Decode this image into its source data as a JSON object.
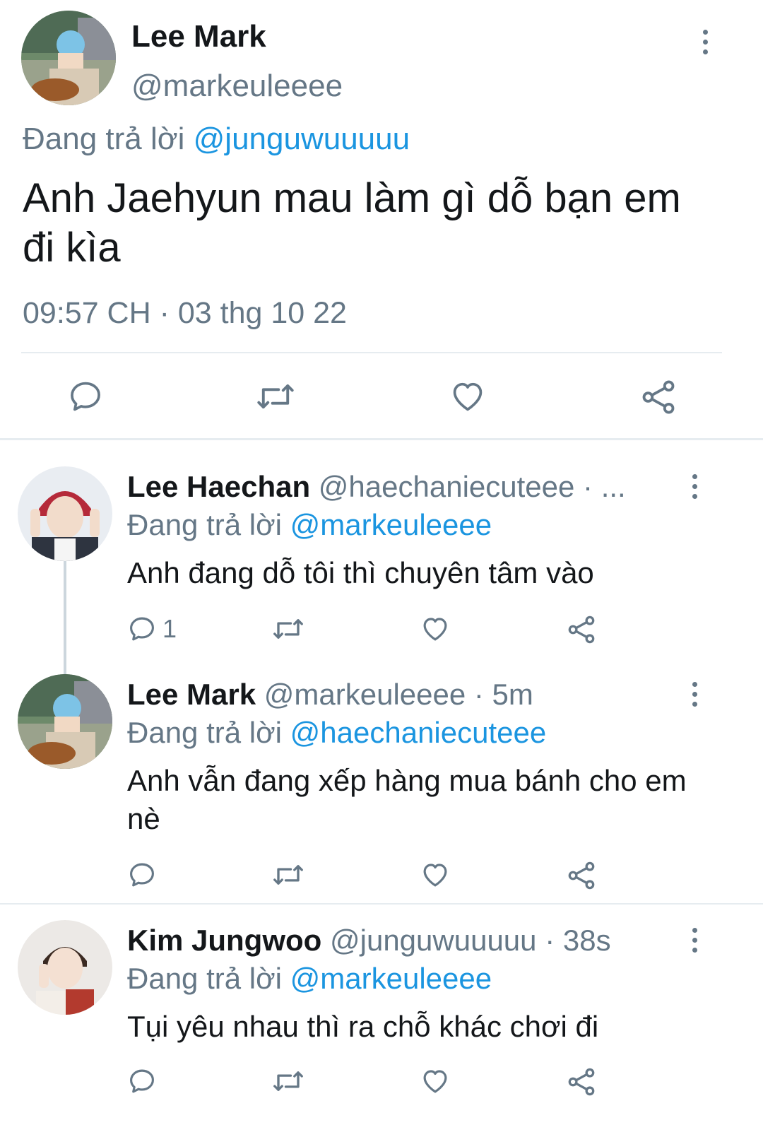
{
  "main_tweet": {
    "author_name": "Lee Mark",
    "author_handle": "@markeuleeee",
    "replying_prefix": "Đang trả lời",
    "replying_to": "@junguwuuuuu",
    "text": "Anh Jaehyun mau làm gì dỗ bạn em đi kìa",
    "timestamp": "09:57 CH · 03 thg 10 22"
  },
  "replies": [
    {
      "author_name": "Lee Haechan",
      "author_handle": "@haechaniecuteee · ...",
      "replying_prefix": "Đang trả lời",
      "replying_to": "@markeuleeee",
      "text": "Anh đang dỗ tôi thì chuyên tâm vào",
      "reply_count": "1"
    },
    {
      "author_name": "Lee Mark",
      "author_handle": "@markeuleeee · 5m",
      "replying_prefix": "Đang trả lời",
      "replying_to": "@haechaniecuteee",
      "text": "Anh vẫn đang xếp hàng mua bánh cho em nè",
      "reply_count": ""
    },
    {
      "author_name": "Kim Jungwoo",
      "author_handle": "@junguwuuuuu · 38s",
      "replying_prefix": "Đang trả lời",
      "replying_to": "@markeuleeee",
      "text": "Tụi yêu nhau thì ra chỗ khác chơi đi",
      "reply_count": ""
    }
  ],
  "icons": {
    "reply": "reply-icon",
    "retweet": "retweet-icon",
    "like": "heart-icon",
    "share": "share-icon",
    "more": "more-vertical-icon"
  },
  "colors": {
    "link": "#1b95e0",
    "secondary_text": "#657786",
    "divider": "#e6ecf0"
  }
}
